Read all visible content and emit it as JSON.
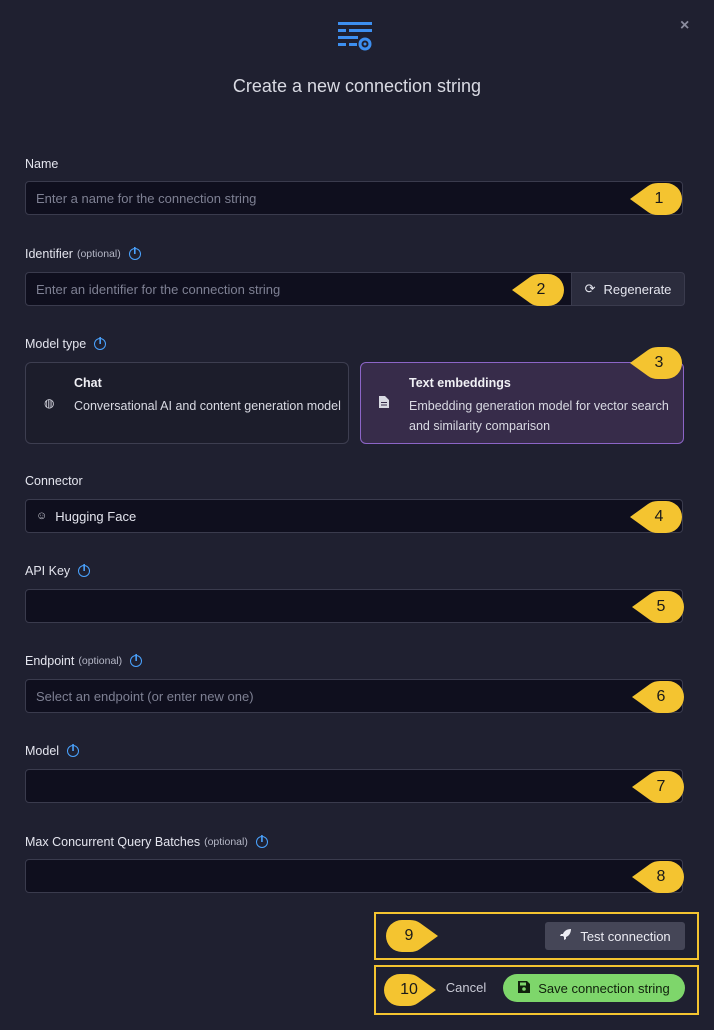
{
  "dialog": {
    "title": "Create a new connection string",
    "close_symbol": "×",
    "header_icon": "connection-settings-icon"
  },
  "name": {
    "label": "Name",
    "placeholder": "Enter a name for the connection string",
    "callout": "1"
  },
  "identifier": {
    "label": "Identifier",
    "optional": "(optional)",
    "placeholder": "Enter an identifier for the connection string",
    "regenerate_label": "Regenerate",
    "callout": "2"
  },
  "model_type": {
    "label": "Model type",
    "callout": "3",
    "options": [
      {
        "title": "Chat",
        "description": "Conversational AI and content generation model",
        "icon": "brain-icon",
        "selected": false
      },
      {
        "title": "Text embeddings",
        "description": "Embedding generation model for vector search and similarity comparison",
        "icon": "document-icon",
        "selected": true
      }
    ]
  },
  "connector": {
    "label": "Connector",
    "value": "Hugging Face",
    "icon": "hugging-face-icon",
    "callout": "4"
  },
  "api_key": {
    "label": "API Key",
    "value": "",
    "callout": "5"
  },
  "endpoint": {
    "label": "Endpoint",
    "optional": "(optional)",
    "placeholder": "Select an endpoint (or enter new one)",
    "callout": "6"
  },
  "model": {
    "label": "Model",
    "value": "",
    "callout": "7"
  },
  "max_batches": {
    "label": "Max Concurrent Query Batches",
    "optional": "(optional)",
    "value": "",
    "callout": "8"
  },
  "actions": {
    "test_label": "Test connection",
    "test_callout": "9",
    "cancel_label": "Cancel",
    "save_label": "Save connection string",
    "save_callout": "10"
  },
  "colors": {
    "accent": "#4aa3ff",
    "callout": "#f4c430",
    "save": "#7ed66b",
    "selected_card": "#372c4a"
  }
}
